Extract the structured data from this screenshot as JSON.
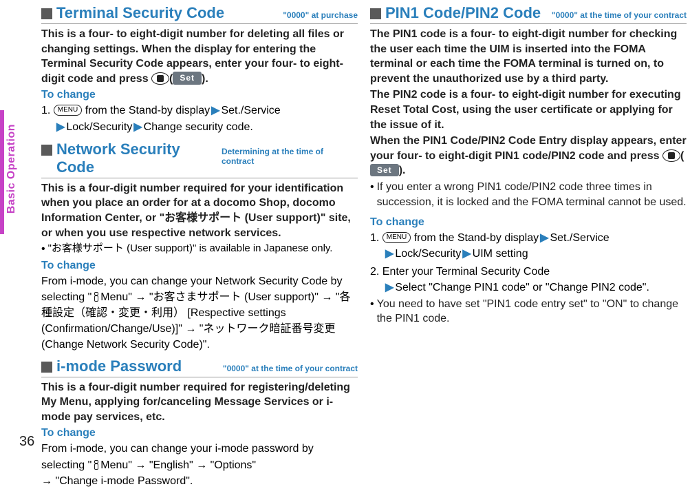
{
  "sidebar": {
    "label": "Basic Operation",
    "page_number": "36"
  },
  "left": {
    "s1": {
      "title": "Terminal Security Code",
      "badge": "\"0000\" at purchase",
      "body": "This is a four- to eight-digit number for deleting all files or changing settings. When the display for entering the Terminal Security Code appears, enter your four- to eight-digit code and press ",
      "set": "Set",
      "tochange": "To change",
      "step_prefix": "1. ",
      "menu": "MENU",
      "step_a": " from the Stand-by display",
      "step_b": "Set./Service",
      "step_c": "Lock/Security",
      "step_d": "Change security code."
    },
    "s2": {
      "title": "Network Security Code",
      "badge": "Determining at the time of contract",
      "body": "This is a four-digit number required for your identification when you place an order for at a docomo Shop, docomo Information Center, or \"お客様サポート (User support)\" site, or when you use respective network services.",
      "note": "\"お客様サポート (User support)\" is available in Japanese only.",
      "tochange": "To change",
      "p1a": "From i-mode, you can change your Network Security Code by selecting \"",
      "p1b": "Menu\" → \"お客さまサポート (User support)\" → \"各種設定（確認・変更・利用） [Respective settings (Confirmation/Change/Use)]\" → \"ネットワーク暗証番号変更 (Change Network Security Code)\"."
    },
    "s3": {
      "title": "i-mode Password",
      "badge": "\"0000\" at the time of your contract",
      "body": "This is a four-digit number required for registering/deleting My Menu, applying for/canceling Message Services or i-mode pay services, etc.",
      "tochange": "To change",
      "p1a": "From i-mode, you can change your i-mode password by selecting \"",
      "p1b": "Menu\" → \"English\" → \"Options\"",
      "p2": "→ \"Change i-mode Password\"."
    }
  },
  "right": {
    "s1": {
      "title": "PIN1 Code/PIN2 Code",
      "badge": "\"0000\" at the time of your contract",
      "body1": "The PIN1 code is a four- to eight-digit number for checking the user each time the UIM is inserted into the FOMA terminal or each time the FOMA terminal is turned on, to prevent the unauthorized use by a third party.",
      "body2": "The PIN2 code is a four- to eight-digit number for executing Reset Total Cost, using the user certificate or applying for the issue of it.",
      "body3": "When the PIN1 Code/PIN2 Code Entry display appears, enter your four- to eight-digit PIN1 code/PIN2 code and press ",
      "set": "Set",
      "note": "If you enter a wrong PIN1 code/PIN2 code three times in succession, it is locked and the FOMA terminal cannot be used.",
      "tochange": "To change",
      "step_prefix": "1. ",
      "menu": "MENU",
      "step_a": " from the Stand-by display",
      "step_b": "Set./Service",
      "step_c": "Lock/Security",
      "step_d": "UIM setting",
      "step2": "2. Enter your Terminal Security Code",
      "step2b": "Select \"Change PIN1 code\" or \"Change PIN2 code\".",
      "note2": "You need to have set \"PIN1 code entry set\" to \"ON\" to change the PIN1 code."
    }
  }
}
